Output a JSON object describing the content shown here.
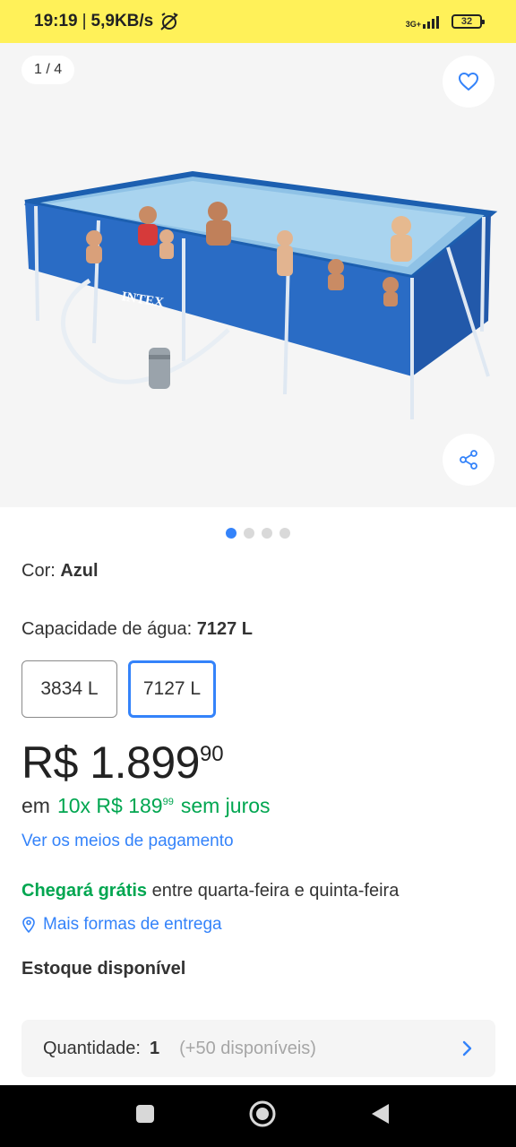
{
  "status_bar": {
    "time": "19:19",
    "separator": "|",
    "speed": "5,9KB/s",
    "network": "3G+",
    "battery": "32",
    "background_color": "#fff159"
  },
  "gallery": {
    "counter": "1 / 4",
    "pool_brand": "INTEX",
    "favorite_icon": "heart-outline-icon",
    "share_icon": "share-icon",
    "pages": 4,
    "active_page": 1
  },
  "product": {
    "color_label": "Cor:",
    "color_value": "Azul",
    "capacity_label": "Capacidade de água:",
    "capacity_value": "7127 L",
    "variants": [
      {
        "label": "3834 L",
        "selected": false
      },
      {
        "label": "7127 L",
        "selected": true
      }
    ]
  },
  "price": {
    "main": "R$ 1.899",
    "cents": "90"
  },
  "installments": {
    "prefix": "em",
    "count_price": "10x R$ 189",
    "cents": "99",
    "suffix": "sem juros"
  },
  "payment_link": "Ver os meios de pagamento",
  "delivery": {
    "highlight": "Chegará grátis",
    "rest": "entre quarta-feira e quinta-feira",
    "more_link": "Mais formas de entrega"
  },
  "stock": "Estoque disponível",
  "quantity": {
    "label": "Quantidade:",
    "value": "1",
    "available": "(+50 disponíveis)"
  },
  "colors": {
    "accent": "#3483fa",
    "green": "#00a650",
    "text": "#333333"
  }
}
